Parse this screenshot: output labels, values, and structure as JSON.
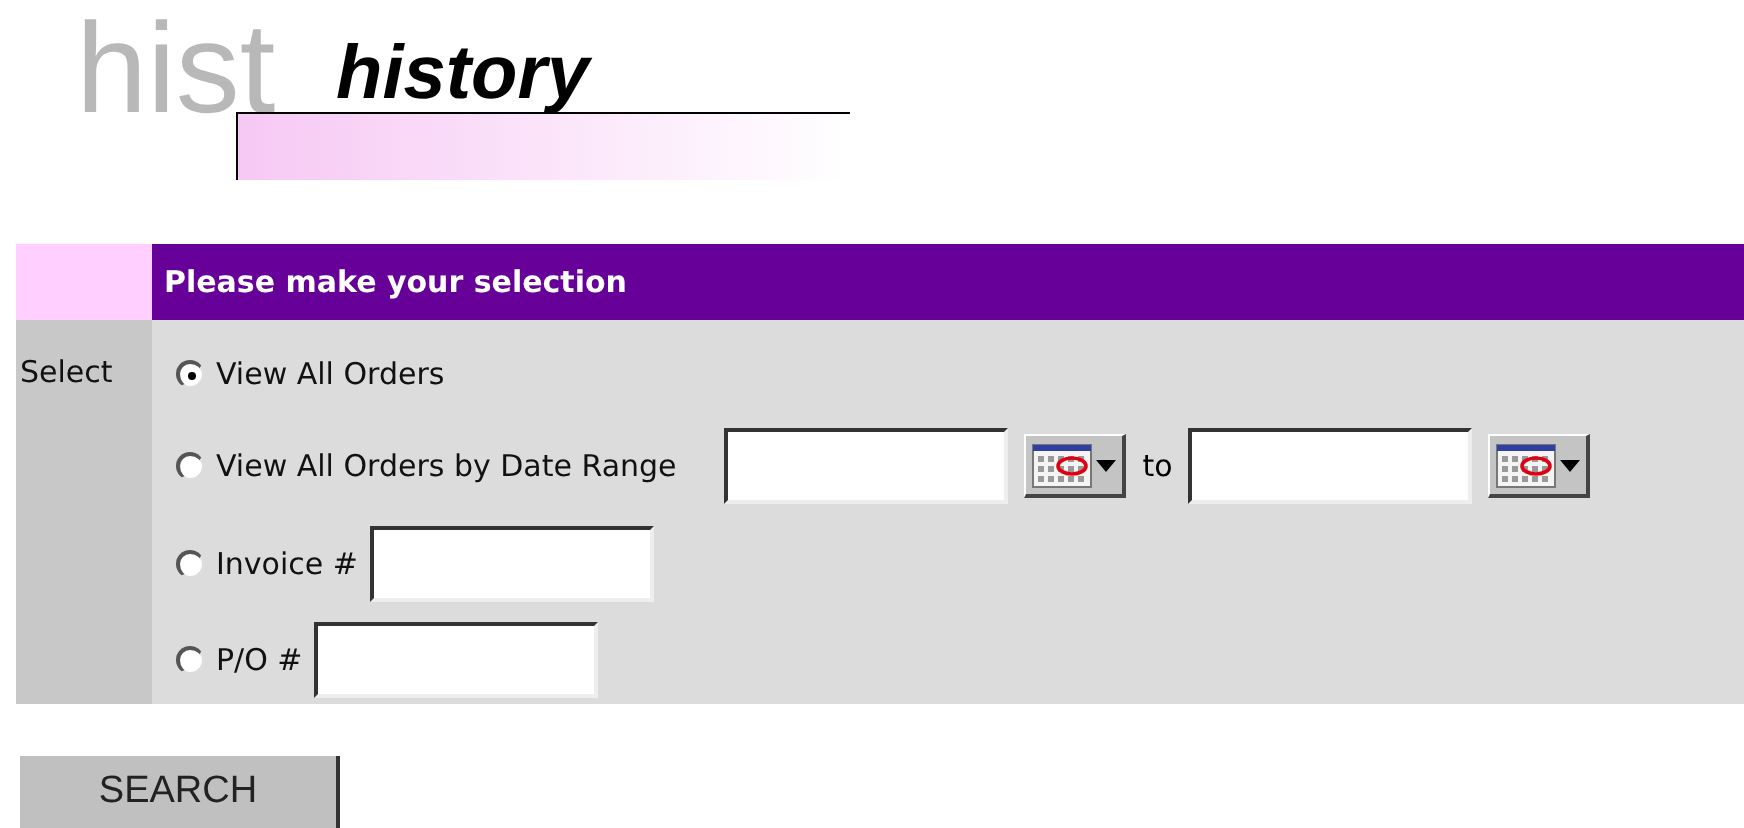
{
  "header": {
    "ghost_text": "hist",
    "title": "history"
  },
  "panel": {
    "heading": "Please make your selection",
    "label": "Select",
    "options": [
      {
        "kind": "plain",
        "label": "View All Orders",
        "selected": true
      },
      {
        "kind": "date_range",
        "label": "View All Orders by Date Range",
        "separator": "to",
        "selected": false
      },
      {
        "kind": "field",
        "label": "Invoice #",
        "selected": false
      },
      {
        "kind": "field",
        "label": "P/O #",
        "selected": false
      }
    ]
  },
  "button": {
    "label": "SEARCH"
  }
}
